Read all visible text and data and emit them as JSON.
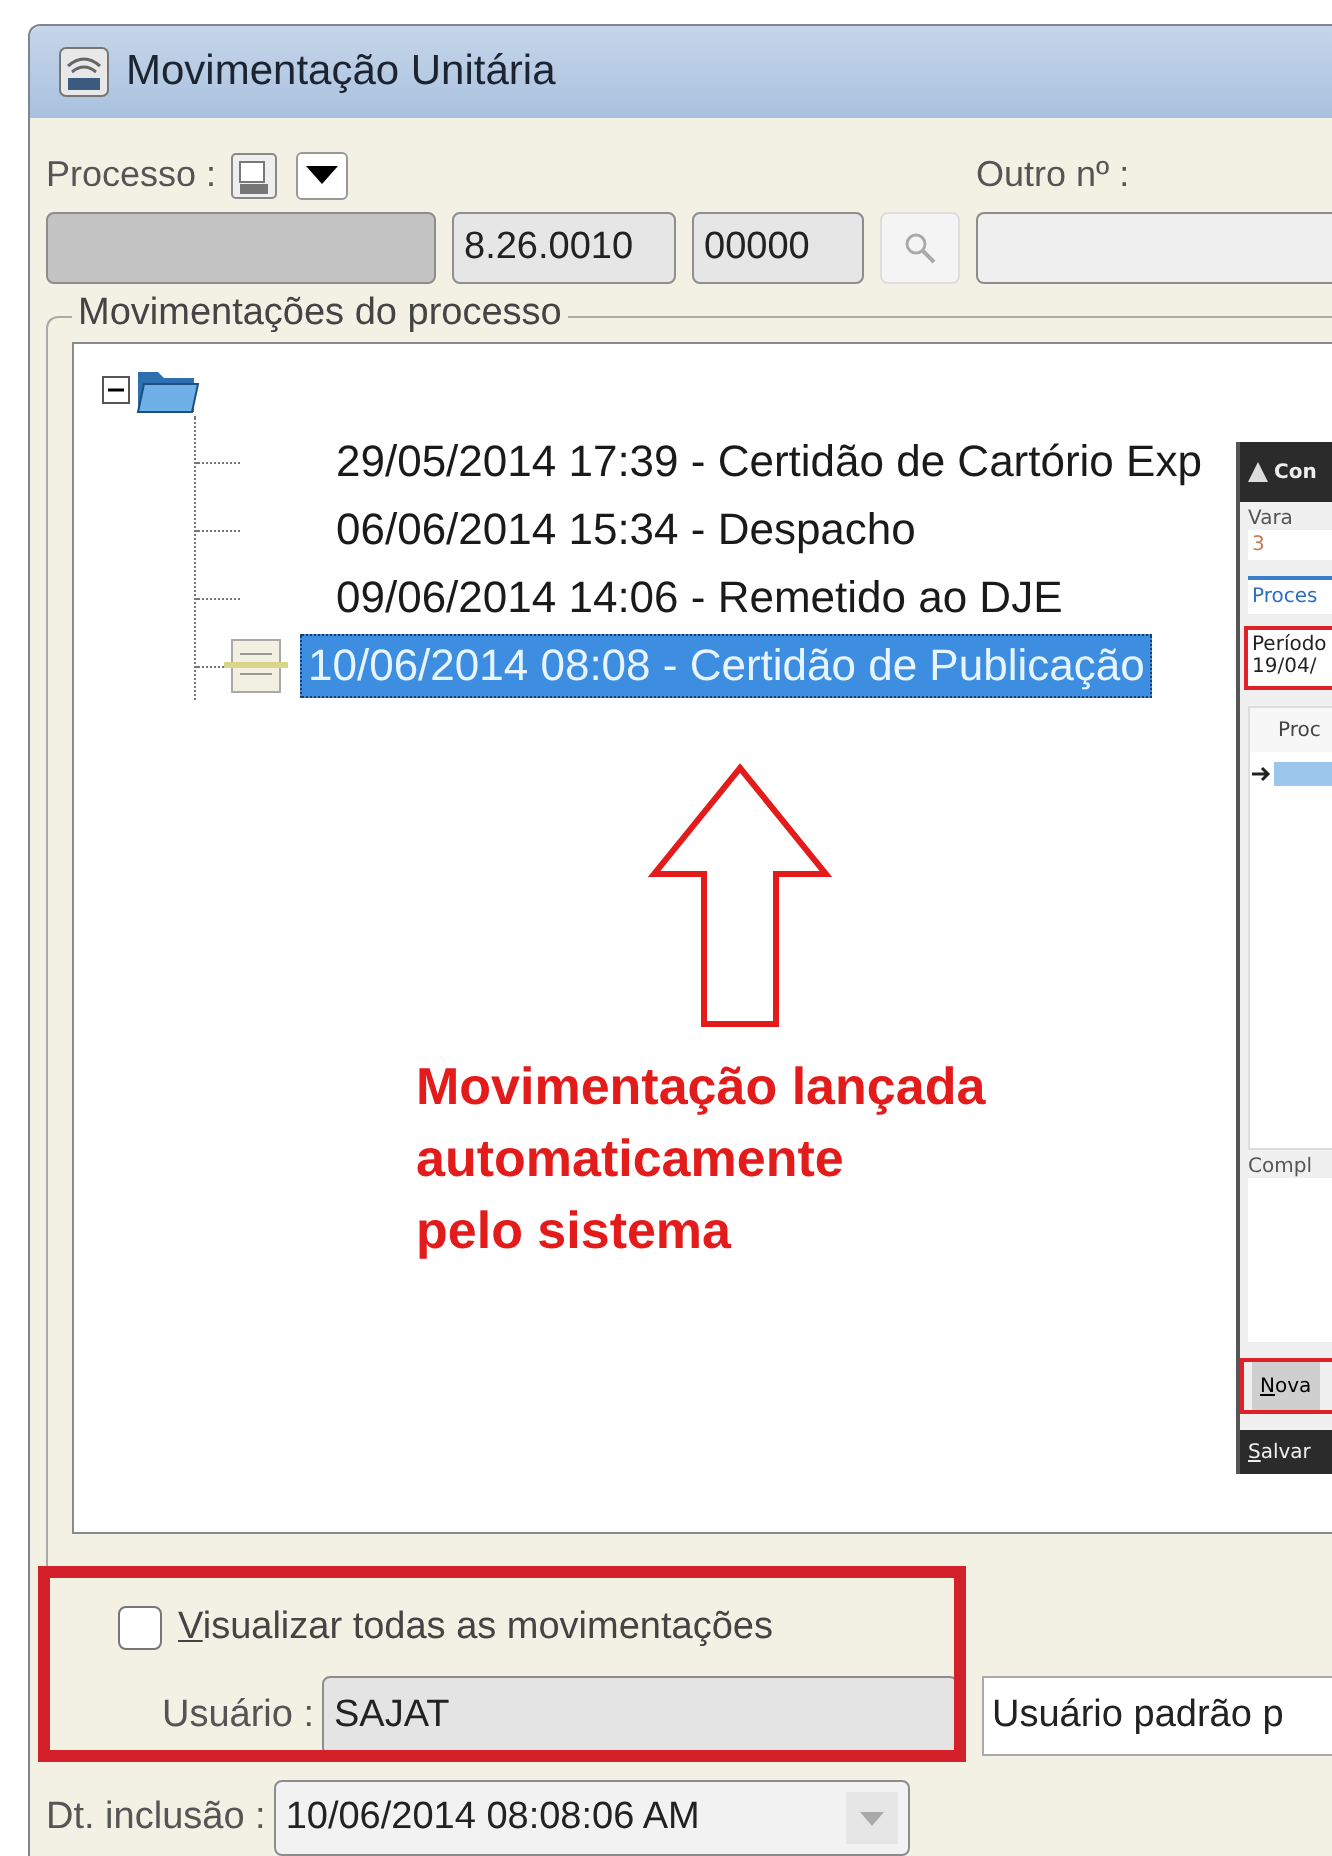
{
  "window": {
    "title": "Movimentação Unitária"
  },
  "processo": {
    "label": "Processo :",
    "number_parts": [
      "8.26.0010",
      "00000"
    ],
    "other_label": "Outro nº :"
  },
  "group": {
    "title": "Movimentações do processo"
  },
  "tree": {
    "expanded": true,
    "children": [
      {
        "label": "29/05/2014 17:39 - Certidão de Cartório Exp",
        "selected": false,
        "kind": "plain"
      },
      {
        "label": "06/06/2014 15:34 - Despacho",
        "selected": false,
        "kind": "plain"
      },
      {
        "label": "09/06/2014 14:06 - Remetido ao DJE",
        "selected": false,
        "kind": "plain"
      },
      {
        "label": "10/06/2014 08:08 - Certidão de Publicação",
        "selected": true,
        "kind": "document"
      }
    ]
  },
  "annotation": {
    "lines": [
      "Movimentação lançada",
      "automaticamente",
      "pelo sistema"
    ]
  },
  "show_all": {
    "label": "Visualizar todas as movimentações",
    "checked": false
  },
  "usuario": {
    "label": "Usuário :",
    "value": "SAJAT",
    "description": "Usuário padrão p"
  },
  "inclusao": {
    "label": "Dt. inclusão :",
    "value": "10/06/2014 08:08:06 AM"
  },
  "dialog": {
    "title": "Con",
    "vara_label": "Vara",
    "vara_value": "3",
    "tab": "Proces",
    "periodo_label": "Período",
    "periodo_value": "19/04/",
    "column": "Proc",
    "complemento_label": "Compl",
    "buttons": [
      "Nova",
      "Salvar"
    ]
  }
}
